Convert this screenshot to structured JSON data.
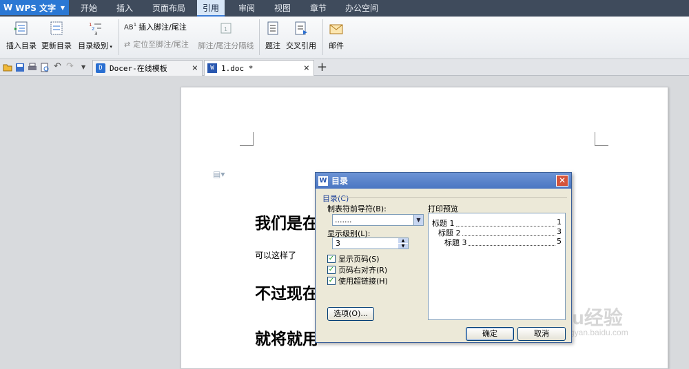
{
  "app": {
    "name": "WPS 文字"
  },
  "menu_tabs": [
    "开始",
    "插入",
    "页面布局",
    "引用",
    "审阅",
    "视图",
    "章节",
    "办公空间"
  ],
  "active_tab_index": 3,
  "ribbon": {
    "insert_toc": "插入目录",
    "update_toc": "更新目录",
    "toc_level": "目录级别",
    "insert_footnote": "插入脚注/尾注",
    "goto_footnote": "定位至脚注/尾注",
    "footnote_separator": "脚注/尾注分隔线",
    "caption": "题注",
    "cross_ref": "交叉引用",
    "mail": "邮件"
  },
  "doc_tabs": [
    {
      "label": "Docer-在线模板"
    },
    {
      "label": "1.doc *"
    }
  ],
  "document": {
    "line1": "我们是在",
    "line2": "可以这样了",
    "line3": "不过现在",
    "line4": "就将就用"
  },
  "dialog": {
    "title": "目录",
    "group_label": "目录(C)",
    "leader_label": "制表符前导符(B):",
    "leader_value": ".......",
    "levels_label": "显示级别(L):",
    "levels_value": "3",
    "show_page_numbers": "显示页码(S)",
    "right_align": "页码右对齐(R)",
    "use_hyperlinks": "使用超链接(H)",
    "options_button": "选项(O)...",
    "preview_label": "打印预览",
    "preview_entries": [
      {
        "label": "标题 1",
        "page": "1"
      },
      {
        "label": "标题 2",
        "page": "3"
      },
      {
        "label": "标题 3",
        "page": "5"
      }
    ],
    "ok_button": "确定",
    "cancel_button": "取消"
  },
  "watermark": {
    "brand": "Baidu经验",
    "url": "jingyan.baidu.com"
  },
  "colors": {
    "menubar": "#3f4b5c",
    "app_button": "#2b78d4",
    "dialog_title": "#4b76c2"
  }
}
